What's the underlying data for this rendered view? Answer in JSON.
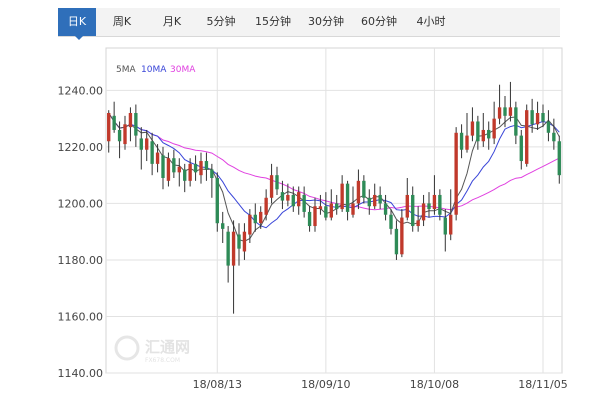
{
  "tabs": [
    {
      "label": "日K",
      "active": true
    },
    {
      "label": "周K",
      "active": false
    },
    {
      "label": "月K",
      "active": false
    },
    {
      "label": "5分钟",
      "active": false
    },
    {
      "label": "15分钟",
      "active": false
    },
    {
      "label": "30分钟",
      "active": false
    },
    {
      "label": "60分钟",
      "active": false
    },
    {
      "label": "4小时",
      "active": false
    }
  ],
  "watermark": {
    "brand": "汇通网",
    "domain": "FX678.COM"
  },
  "colors": {
    "up": "#c0392b",
    "down": "#2e8b57",
    "ma5": "#555555",
    "ma10": "#3a46d8",
    "ma30": "#e040e0",
    "grid": "#e2e2e2"
  },
  "chart_data": {
    "type": "candlestick",
    "legend": [
      "5MA",
      "10MA",
      "30MA"
    ],
    "y_ticks": [
      "1240.00",
      "1220.00",
      "1200.00",
      "1180.00",
      "1160.00",
      "1140.00"
    ],
    "y_tick_values": [
      1240,
      1220,
      1200,
      1180,
      1160,
      1140
    ],
    "ylim": [
      1140,
      1255
    ],
    "x_ticks": [
      {
        "label": "18/08/13",
        "index": 20
      },
      {
        "label": "18/09/10",
        "index": 40
      },
      {
        "label": "18/10/08",
        "index": 60
      },
      {
        "label": "18/11/05",
        "index": 80
      }
    ],
    "candles": [
      [
        1222,
        1232,
        1233,
        1218
      ],
      [
        1231,
        1226,
        1236,
        1225
      ],
      [
        1226,
        1222,
        1229,
        1216
      ],
      [
        1221,
        1228,
        1231,
        1219
      ],
      [
        1227,
        1232,
        1234,
        1222
      ],
      [
        1232,
        1224,
        1235,
        1220
      ],
      [
        1223,
        1219,
        1227,
        1212
      ],
      [
        1219,
        1223,
        1226,
        1215
      ],
      [
        1222,
        1214,
        1225,
        1210
      ],
      [
        1214,
        1218,
        1221,
        1211
      ],
      [
        1217,
        1209,
        1220,
        1205
      ],
      [
        1208,
        1216,
        1218,
        1206
      ],
      [
        1216,
        1211,
        1219,
        1209
      ],
      [
        1211,
        1213,
        1216,
        1206
      ],
      [
        1212,
        1208,
        1214,
        1204
      ],
      [
        1208,
        1214,
        1216,
        1206
      ],
      [
        1214,
        1211,
        1217,
        1208
      ],
      [
        1210,
        1215,
        1218,
        1207
      ],
      [
        1215,
        1212,
        1218,
        1208
      ],
      [
        1212,
        1209,
        1214,
        1202
      ],
      [
        1209,
        1193,
        1211,
        1190
      ],
      [
        1193,
        1191,
        1197,
        1186
      ],
      [
        1190,
        1178,
        1192,
        1172
      ],
      [
        1178,
        1190,
        1194,
        1161
      ],
      [
        1189,
        1184,
        1193,
        1178
      ],
      [
        1183,
        1190,
        1193,
        1180
      ],
      [
        1189,
        1196,
        1198,
        1186
      ],
      [
        1196,
        1193,
        1200,
        1190
      ],
      [
        1193,
        1197,
        1199,
        1191
      ],
      [
        1196,
        1202,
        1205,
        1194
      ],
      [
        1202,
        1210,
        1214,
        1200
      ],
      [
        1210,
        1205,
        1213,
        1203
      ],
      [
        1204,
        1201,
        1208,
        1198
      ],
      [
        1201,
        1203,
        1207,
        1199
      ],
      [
        1203,
        1199,
        1206,
        1197
      ],
      [
        1199,
        1204,
        1206,
        1196
      ],
      [
        1203,
        1197,
        1206,
        1195
      ],
      [
        1197,
        1192,
        1199,
        1190
      ],
      [
        1192,
        1199,
        1202,
        1190
      ],
      [
        1198,
        1199,
        1203,
        1196
      ],
      [
        1199,
        1195,
        1204,
        1194
      ],
      [
        1195,
        1200,
        1205,
        1194
      ],
      [
        1200,
        1198,
        1203,
        1196
      ],
      [
        1198,
        1207,
        1210,
        1197
      ],
      [
        1207,
        1197,
        1208,
        1194
      ],
      [
        1196,
        1200,
        1206,
        1195
      ],
      [
        1200,
        1208,
        1212,
        1198
      ],
      [
        1208,
        1202,
        1210,
        1200
      ],
      [
        1202,
        1199,
        1205,
        1196
      ],
      [
        1199,
        1203,
        1207,
        1198
      ],
      [
        1203,
        1200,
        1206,
        1198
      ],
      [
        1200,
        1196,
        1203,
        1194
      ],
      [
        1196,
        1191,
        1198,
        1189
      ],
      [
        1191,
        1182,
        1194,
        1180
      ],
      [
        1182,
        1195,
        1198,
        1181
      ],
      [
        1195,
        1203,
        1209,
        1194
      ],
      [
        1203,
        1192,
        1206,
        1190
      ],
      [
        1192,
        1194,
        1199,
        1190
      ],
      [
        1194,
        1200,
        1203,
        1192
      ],
      [
        1200,
        1198,
        1204,
        1195
      ],
      [
        1198,
        1203,
        1210,
        1196
      ],
      [
        1203,
        1196,
        1205,
        1194
      ],
      [
        1195,
        1189,
        1198,
        1183
      ],
      [
        1189,
        1196,
        1205,
        1187
      ],
      [
        1196,
        1225,
        1227,
        1194
      ],
      [
        1225,
        1219,
        1228,
        1216
      ],
      [
        1219,
        1224,
        1232,
        1218
      ],
      [
        1224,
        1229,
        1234,
        1222
      ],
      [
        1229,
        1222,
        1231,
        1219
      ],
      [
        1222,
        1226,
        1232,
        1220
      ],
      [
        1226,
        1223,
        1229,
        1219
      ],
      [
        1223,
        1230,
        1236,
        1221
      ],
      [
        1230,
        1234,
        1242,
        1228
      ],
      [
        1234,
        1231,
        1238,
        1227
      ],
      [
        1231,
        1234,
        1243,
        1229
      ],
      [
        1234,
        1224,
        1236,
        1221
      ],
      [
        1224,
        1215,
        1226,
        1212
      ],
      [
        1214,
        1233,
        1235,
        1213
      ],
      [
        1233,
        1228,
        1237,
        1225
      ],
      [
        1228,
        1232,
        1236,
        1226
      ],
      [
        1232,
        1229,
        1235,
        1227
      ],
      [
        1229,
        1225,
        1233,
        1222
      ],
      [
        1225,
        1222,
        1230,
        1219
      ],
      [
        1222,
        1210,
        1224,
        1207
      ]
    ]
  }
}
